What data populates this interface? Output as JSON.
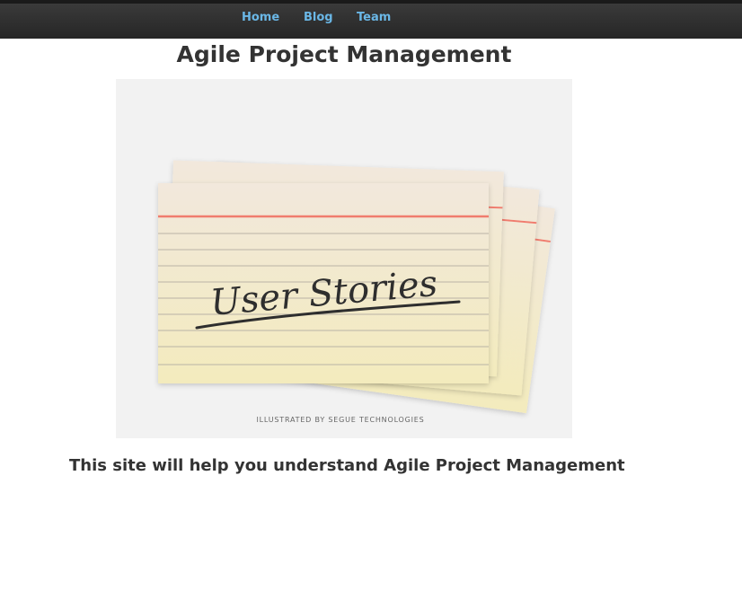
{
  "nav": {
    "items": [
      {
        "label": "Home"
      },
      {
        "label": "Blog"
      },
      {
        "label": "Team"
      }
    ],
    "link_color": "#6ab7e6"
  },
  "page": {
    "title": "Agile Project Management",
    "tagline": "This site will help you understand Agile Project Management"
  },
  "hero_image": {
    "handwritten_text": "User Stories",
    "credit": "ILLUSTRATED BY SEGUE TECHNOLOGIES"
  }
}
